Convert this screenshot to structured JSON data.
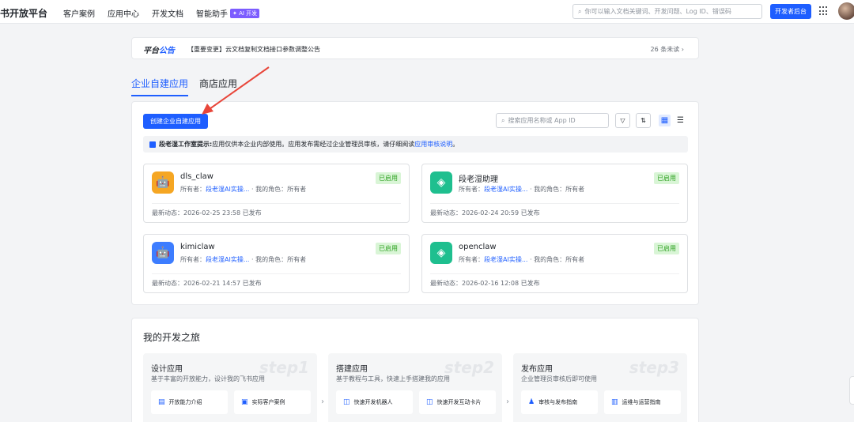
{
  "header": {
    "brand": "书开放平台",
    "nav": [
      "客户案例",
      "应用中心",
      "开发文档"
    ],
    "ai_label": "智能助手",
    "ai_badge": "✦ AI 开发",
    "search_placeholder": "你可以输入文档关键词、开发问题、Log ID、错误码",
    "dev_console": "开发者后台"
  },
  "announcement": {
    "logo_a": "平台",
    "logo_b": "公告",
    "text": "【重要变更】云文档复制文档接口参数调整公告",
    "unread": "26 条未读 ›"
  },
  "tabs": [
    "企业自建应用",
    "商店应用"
  ],
  "panel": {
    "create_button": "创建企业自建应用",
    "search_placeholder": "搜索应用名称或 App ID",
    "tip_title": "段老湿工作室提示:",
    "tip_text": "应用仅供本企业内部使用。应用发布需经过企业管理员审核，请仔细阅读",
    "tip_link": "应用审核说明",
    "tip_end": "。",
    "owner_label": "所有者：",
    "role_label": "我的角色：",
    "latest_label": "最新动态：",
    "apps": [
      {
        "name": "dls_claw",
        "owner": "段老湿AI实操...",
        "role": "所有者",
        "status": "已启用",
        "latest": "2026-02-25 23:58 已发布",
        "icon": "robot-icon",
        "color": "#f5a623"
      },
      {
        "name": "段老湿助理",
        "owner": "段老湿AI实操...",
        "role": "所有者",
        "status": "已启用",
        "latest": "2026-02-24 20:59 已发布",
        "icon": "cube-icon",
        "color": "#1fbf8f"
      },
      {
        "name": "kimiclaw",
        "owner": "段老湿AI实操...",
        "role": "所有者",
        "status": "已启用",
        "latest": "2026-02-21 14:57 已发布",
        "icon": "robot-icon",
        "color": "#3d7dff"
      },
      {
        "name": "openclaw",
        "owner": "段老湿AI实操...",
        "role": "所有者",
        "status": "已启用",
        "latest": "2026-02-16 12:08 已发布",
        "icon": "cube-icon",
        "color": "#1fbf8f"
      }
    ]
  },
  "journey": {
    "title": "我的开发之旅",
    "steps": [
      {
        "title": "设计应用",
        "desc": "基于丰富的开放能力，设计我的飞书应用",
        "num": "step1",
        "buttons": [
          "开放能力介绍",
          "实际客户案例"
        ]
      },
      {
        "title": "搭建应用",
        "desc": "基于教程与工具，快速上手搭建我的应用",
        "num": "step2",
        "buttons": [
          "快速开发机器人",
          "快速开发互动卡片"
        ]
      },
      {
        "title": "发布应用",
        "desc": "企业管理员审核后即可使用",
        "num": "step3",
        "buttons": [
          "审核与发布指南",
          "运维与运营指南"
        ]
      }
    ]
  }
}
